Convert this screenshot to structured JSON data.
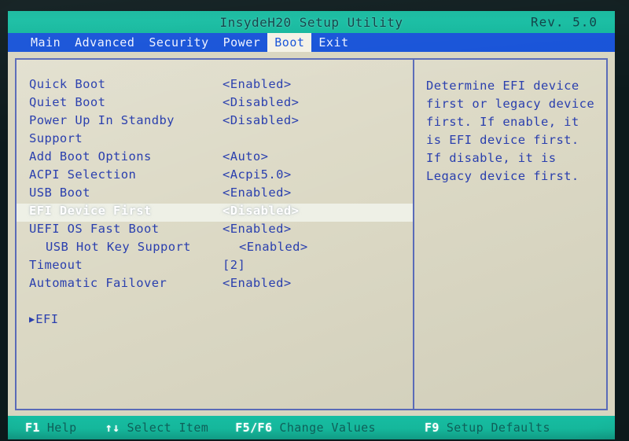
{
  "window": {
    "title": "InsydeH20 Setup Utility",
    "revision": "Rev. 5.0"
  },
  "menu_bar": {
    "tabs": [
      {
        "label": "Main",
        "active": false
      },
      {
        "label": "Advanced",
        "active": false
      },
      {
        "label": "Security",
        "active": false
      },
      {
        "label": "Power",
        "active": false
      },
      {
        "label": "Boot",
        "active": true
      },
      {
        "label": "Exit",
        "active": false
      }
    ]
  },
  "settings": {
    "rows": [
      {
        "label": "Quick Boot",
        "value": "<Enabled>",
        "selected": false,
        "indented": false,
        "submenu": false
      },
      {
        "label": "Quiet Boot",
        "value": "<Disabled>",
        "selected": false,
        "indented": false,
        "submenu": false
      },
      {
        "label": "Power Up In Standby",
        "value": "<Disabled>",
        "selected": false,
        "indented": false,
        "submenu": false
      },
      {
        "label": "Support",
        "value": "",
        "selected": false,
        "indented": false,
        "submenu": false
      },
      {
        "label": "Add Boot Options",
        "value": "<Auto>",
        "selected": false,
        "indented": false,
        "submenu": false
      },
      {
        "label": "ACPI Selection",
        "value": "<Acpi5.0>",
        "selected": false,
        "indented": false,
        "submenu": false
      },
      {
        "label": "USB Boot",
        "value": "<Enabled>",
        "selected": false,
        "indented": false,
        "submenu": false
      },
      {
        "label": "EFI Device First",
        "value": "<Disabled>",
        "selected": true,
        "indented": false,
        "submenu": false
      },
      {
        "label": "UEFI OS Fast Boot",
        "value": "<Enabled>",
        "selected": false,
        "indented": false,
        "submenu": false
      },
      {
        "label": "USB Hot Key Support",
        "value": "<Enabled>",
        "selected": false,
        "indented": true,
        "submenu": false
      },
      {
        "label": "Timeout",
        "value": "[2]",
        "selected": false,
        "indented": false,
        "submenu": false
      },
      {
        "label": "Automatic Failover",
        "value": "<Enabled>",
        "selected": false,
        "indented": false,
        "submenu": false
      }
    ],
    "submenu_item": {
      "label": "EFI",
      "icon": "right-triangle-icon"
    }
  },
  "help": {
    "text": "Determine EFI device first or legacy device first. If enable, it is EFI device first. If disable, it is Legacy device first."
  },
  "footer": {
    "keys": [
      {
        "key": "F1",
        "desc": "Help"
      },
      {
        "key": "↑↓",
        "desc": "Select Item"
      },
      {
        "key": "F5/F6",
        "desc": "Change Values"
      },
      {
        "key": "F9",
        "desc": "Setup Defaults"
      }
    ]
  },
  "colors": {
    "title_bar": "#16bda2",
    "menu_bar": "#1652d8",
    "panel_bg": "#dad7c2",
    "text_blue": "#2a3fae",
    "border_blue": "#5a6bb8",
    "footer_bar": "#15b79b"
  }
}
